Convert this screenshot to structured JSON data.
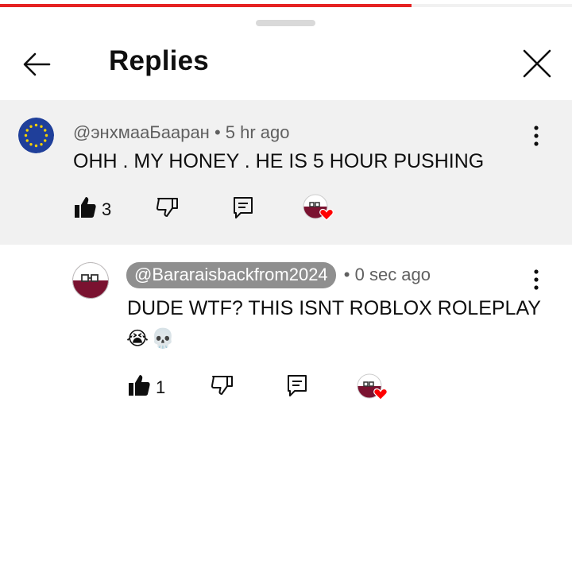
{
  "progress": {
    "fraction": 0.72,
    "color": "#e52222"
  },
  "header": {
    "title": "Replies",
    "back_icon": "arrow-left-icon",
    "close_icon": "close-icon"
  },
  "parent_comment": {
    "author": "@энхмааБааран",
    "time": "• 5 hr ago",
    "text": "OHH . MY HONEY . HE IS 5 HOUR PUSHING",
    "likes": "3",
    "avatar_icon": "eu-flag-avatar"
  },
  "reply": {
    "author": "@Bararaisbackfrom2024",
    "time": "• 0 sec ago",
    "text_line1": "DUDE WTF? THIS ISNT ROBLOX ROLEPLAY",
    "emoji_1": "😭",
    "emoji_2": "💀",
    "likes": "1",
    "avatar_icon": "countryball-avatar"
  },
  "colors": {
    "highlight_bg": "#f1f1f1",
    "meta_text": "#606060",
    "heart": "#ff0000"
  }
}
